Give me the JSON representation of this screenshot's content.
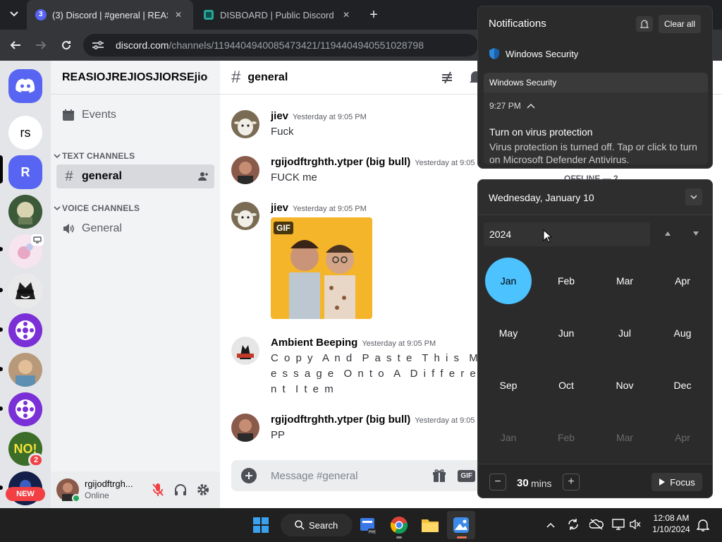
{
  "browser": {
    "tabs": [
      {
        "title": "(3) Discord | #general | REASIOJ",
        "favicon_badge": "3",
        "active": true
      },
      {
        "title": "DISBOARD | Public Discord Serv",
        "active": false
      }
    ],
    "url_host": "discord.com",
    "url_path": "/channels/1194404940085473421/1194404940551028798"
  },
  "discord": {
    "server_name": "REASIOJREJIOSJIORSEjio",
    "events_label": "Events",
    "text_category": "TEXT CHANNELS",
    "voice_category": "VOICE CHANNELS",
    "text_channel": "general",
    "voice_channel": "General",
    "channel_header": "general",
    "guild_list": [
      {
        "label": "rs",
        "kind": "text"
      },
      {
        "label": "R",
        "kind": "text",
        "selected": true
      },
      {
        "label": "",
        "kind": "image"
      },
      {
        "label": "",
        "kind": "image"
      },
      {
        "label": "",
        "kind": "image"
      },
      {
        "label": "",
        "kind": "image"
      },
      {
        "label": "",
        "kind": "image"
      },
      {
        "label": "",
        "kind": "image"
      },
      {
        "label": "",
        "kind": "image",
        "badge": "2"
      },
      {
        "label": "NEW",
        "kind": "image"
      }
    ],
    "messages": [
      {
        "author": "jiev",
        "time": "Yesterday at 9:05 PM",
        "text": "Fuck"
      },
      {
        "author": "rgijodftrghth.ytper (big bull)",
        "time": "Yesterday at 9:05 PM",
        "text": "FUCK me"
      },
      {
        "author": "jiev",
        "time": "Yesterday at 9:05 PM",
        "text": "",
        "gif_label": "GIF"
      },
      {
        "author": "Ambient Beeping",
        "time": "Yesterday at 9:05 PM",
        "text": "C o p y  A n d  P a s t e  T h i s  M e s s a g e  O n t o  A  D i f f e r e n t  I t e m"
      },
      {
        "author": "rgijodftrghth.ytper (big bull)",
        "time": "Yesterday at 9:05 PM",
        "text": "PP"
      }
    ],
    "composer_placeholder": "Message #general",
    "user": {
      "name": "rgijodftrgh...",
      "status": "Online"
    },
    "member_list_peek": "OFFLINE — 2"
  },
  "notifications": {
    "title": "Notifications",
    "clear_all": "Clear all",
    "app_name": "Windows Security",
    "group_name": "Windows Security",
    "time": "9:27 PM",
    "toast_title": "Turn on virus protection",
    "toast_body": "Virus protection is turned off. Tap or click to turn on Microsoft Defender Antivirus."
  },
  "calendar": {
    "date_header": "Wednesday, January 10",
    "year": "2024",
    "months": [
      "Jan",
      "Feb",
      "Mar",
      "Apr",
      "May",
      "Jun",
      "Jul",
      "Aug",
      "Sep",
      "Oct",
      "Nov",
      "Dec"
    ],
    "next_months": [
      "Jan",
      "Feb",
      "Mar",
      "Apr"
    ],
    "selected_month": "Jan",
    "focus_minutes": "30",
    "focus_unit": "mins",
    "focus_button": "Focus"
  },
  "taskbar": {
    "search_label": "Search",
    "clock_time": "12:08 AM",
    "clock_date": "1/10/2024"
  },
  "colors": {
    "accent": "#4cc2ff",
    "discord_blurple": "#5865f2",
    "online": "#23a55a",
    "badge_red": "#f23f43"
  }
}
